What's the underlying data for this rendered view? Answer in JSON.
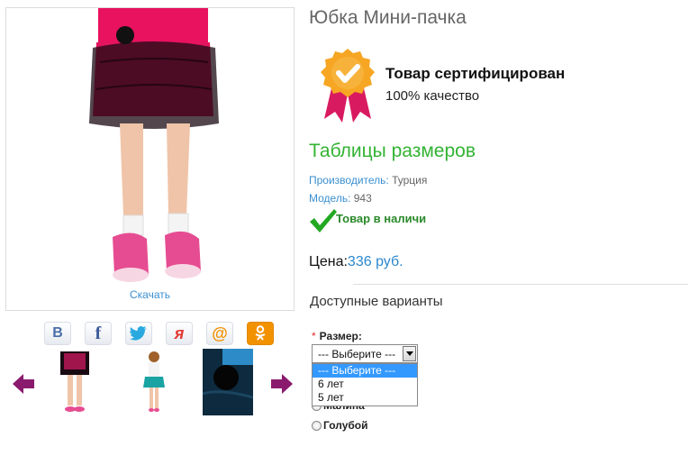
{
  "product": {
    "title": "Юбка Мини-пачка",
    "download_label": "Скачать"
  },
  "share": {
    "buttons": [
      {
        "icon": "vk-icon",
        "glyph": "B",
        "color": "#4a6ea8"
      },
      {
        "icon": "facebook-icon",
        "glyph": "f",
        "color": "#3b5998"
      },
      {
        "icon": "twitter-icon",
        "glyph": "",
        "color": "#2aa9e0"
      },
      {
        "icon": "yaru-icon",
        "glyph": "я",
        "color": "#e53935"
      },
      {
        "icon": "mailru-icon",
        "glyph": "@",
        "color": "#f39200"
      },
      {
        "icon": "odnoklassniki-icon",
        "glyph": "ok",
        "color": "#f39200"
      }
    ]
  },
  "certificate": {
    "title": "Товар сертифицирован",
    "subtitle": "100% качество"
  },
  "size_tables_label": "Таблицы размеров",
  "meta": {
    "manufacturer_key": "Производитель:",
    "manufacturer_value": "Турция",
    "model_key": "Модель:",
    "model_value": "943"
  },
  "stock_status": "Товар в наличи",
  "price": {
    "label": "Цена:",
    "value": "336 руб."
  },
  "options": {
    "heading": "Доступные варианты",
    "size_label": "Размер:",
    "required_mark": "*",
    "selected": "--- Выберите ---",
    "dropdown_options": [
      "--- Выберите ---",
      "6 лет",
      "5 лет"
    ],
    "color_options": [
      "Малина",
      "Голубой"
    ]
  },
  "colors": {
    "accent_blue": "#3a8fd0",
    "accent_green": "#33b333",
    "price_blue": "#2b88cf",
    "arrow_purple": "#8a1a6e"
  }
}
